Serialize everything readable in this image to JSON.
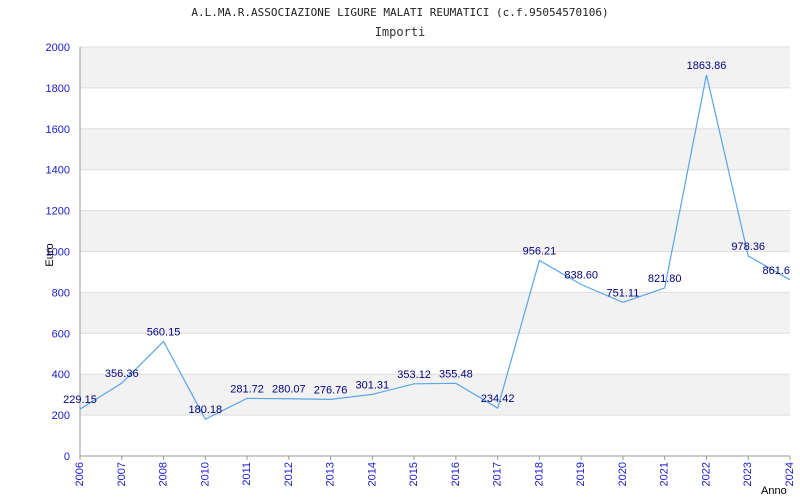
{
  "chart_data": {
    "type": "line",
    "title": "A.L.MA.R.ASSOCIAZIONE LIGURE MALATI REUMATICI (c.f.95054570106)",
    "subtitle": "Importi",
    "ylabel": "Euro",
    "xlabel": "Anno",
    "ylim": [
      0,
      2000
    ],
    "yticks": [
      0,
      200,
      400,
      600,
      800,
      1000,
      1200,
      1400,
      1600,
      1800,
      2000
    ],
    "categories": [
      "2006",
      "2007",
      "2008",
      "2010",
      "2011",
      "2012",
      "2013",
      "2014",
      "2015",
      "2016",
      "2017",
      "2018",
      "2019",
      "2020",
      "2021",
      "2022",
      "2023",
      "2024"
    ],
    "values": [
      229.15,
      356.36,
      560.15,
      180.18,
      281.72,
      280.07,
      276.76,
      301.31,
      353.12,
      355.48,
      234.42,
      956.21,
      838.6,
      751.11,
      821.8,
      1863.86,
      978.36,
      861.6
    ],
    "labels": [
      "229.15",
      "356.36",
      "560.15",
      "180.18",
      "281.72",
      "280.07",
      "276.76",
      "301.31",
      "353.12",
      "355.48",
      "234.42",
      "956.21",
      "838.60",
      "751.11",
      "821.80",
      "1863.86",
      "978.36",
      "861.6"
    ],
    "grid": true,
    "colors": {
      "line": "#5aa5e8",
      "band": "#f2f2f2",
      "tick_text": "#1a1acc",
      "data_label": "#000080",
      "grid": "#dddddd"
    }
  }
}
